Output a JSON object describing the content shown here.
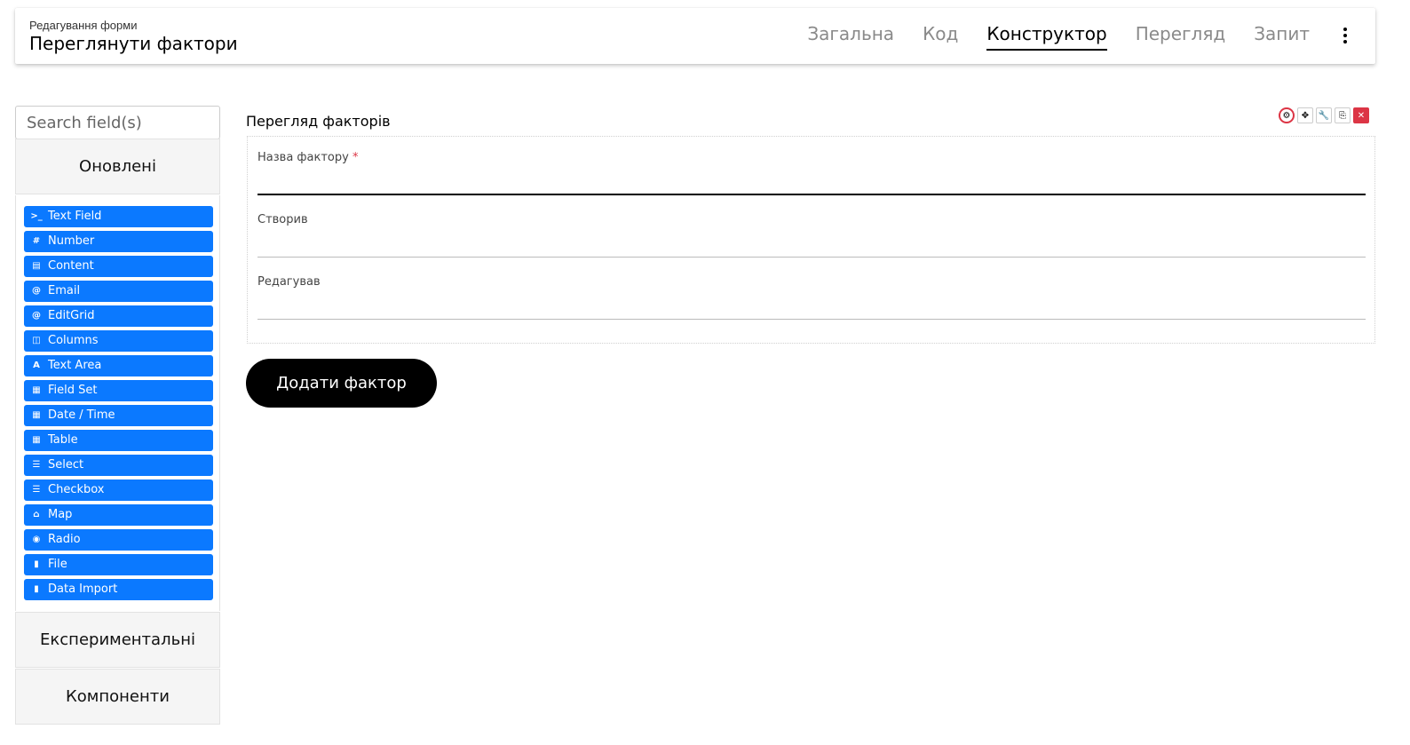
{
  "header": {
    "subtitle": "Редагування форми",
    "title": "Переглянути фактори",
    "tabs": [
      {
        "label": "Загальна",
        "active": false
      },
      {
        "label": "Код",
        "active": false
      },
      {
        "label": "Конструктор",
        "active": true
      },
      {
        "label": "Перегляд",
        "active": false
      },
      {
        "label": "Запит",
        "active": false
      }
    ],
    "menu_icon": "kebab-menu-icon"
  },
  "sidebar": {
    "search_placeholder": "Search field(s)",
    "groups": [
      "Оновлені",
      "Експериментальні",
      "Компоненти"
    ],
    "components": [
      {
        "label": "Text Field",
        "icon": ">_"
      },
      {
        "label": "Number",
        "icon": "#"
      },
      {
        "label": "Content",
        "icon": "▤"
      },
      {
        "label": "Email",
        "icon": "@"
      },
      {
        "label": "EditGrid",
        "icon": "@"
      },
      {
        "label": "Columns",
        "icon": "◫"
      },
      {
        "label": "Text Area",
        "icon": "A"
      },
      {
        "label": "Field Set",
        "icon": "▦"
      },
      {
        "label": "Date / Time",
        "icon": "▦"
      },
      {
        "label": "Table",
        "icon": "▦"
      },
      {
        "label": "Select",
        "icon": "☰"
      },
      {
        "label": "Checkbox",
        "icon": "☰"
      },
      {
        "label": "Map",
        "icon": "⌂"
      },
      {
        "label": "Radio",
        "icon": "◉"
      },
      {
        "label": "File",
        "icon": "▮"
      },
      {
        "label": "Data Import",
        "icon": "▮"
      }
    ],
    "accent_color": "#0b79ff"
  },
  "form": {
    "panel_title": "Перегляд факторів",
    "fields": [
      {
        "label": "Назва фактору",
        "required": true,
        "value": ""
      },
      {
        "label": "Створив",
        "required": false,
        "value": ""
      },
      {
        "label": "Редагував",
        "required": false,
        "value": ""
      }
    ],
    "required_mark": "*",
    "submit_label": "Додати фактор",
    "toolbar_icons": [
      "gear-icon",
      "move-icon",
      "wrench-icon",
      "copy-icon",
      "delete-icon"
    ]
  }
}
